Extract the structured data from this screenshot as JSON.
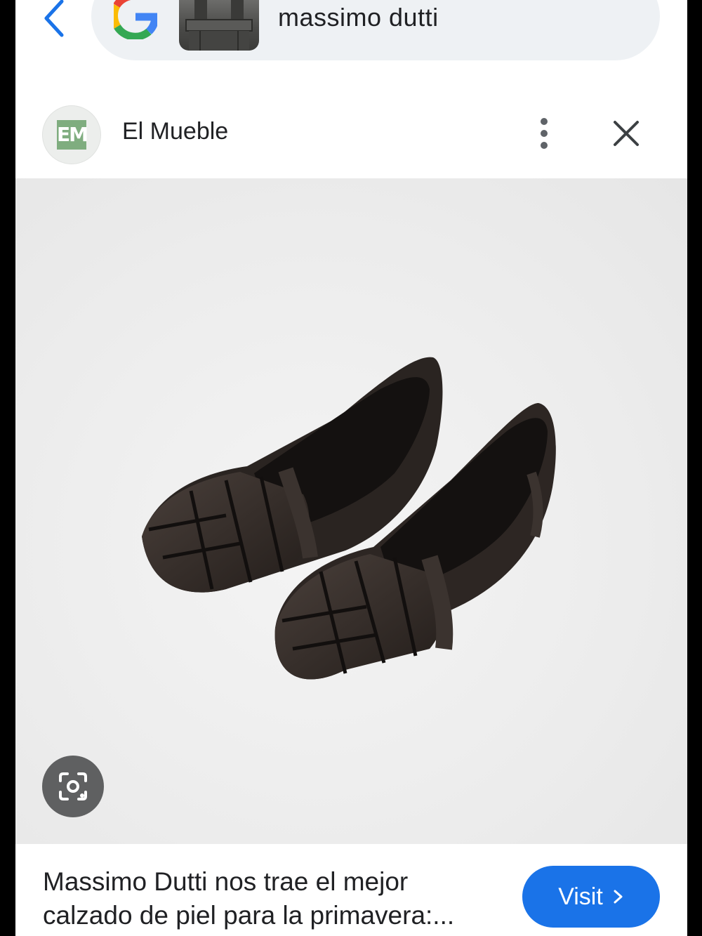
{
  "search": {
    "query": "massimo dutti",
    "back_icon": "back-chevron-icon",
    "logo_icon": "google-g-icon"
  },
  "source": {
    "logo_text": "EM",
    "name": "El Mueble",
    "more_icon": "more-vert-icon",
    "close_icon": "close-icon"
  },
  "result": {
    "caption_line1": "Massimo Dutti nos trae el mejor",
    "caption_line2": "calzado de piel para la primavera:...",
    "visit_label": "Visit",
    "lens_icon": "lens-search-icon"
  },
  "colors": {
    "accent": "#1a73e8",
    "pill_bg": "#eef1f4",
    "lens_bg": "#5f6061"
  }
}
